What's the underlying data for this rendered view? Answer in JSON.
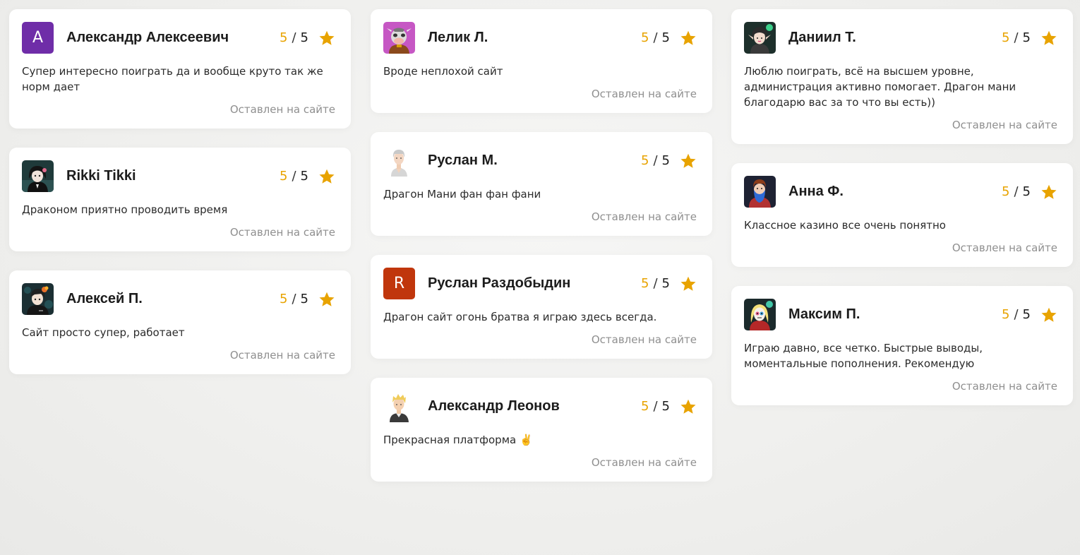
{
  "colors": {
    "accent": "#e8a300",
    "card_bg": "#ffffff",
    "page_bg": "#efefed"
  },
  "columns": [
    {
      "reviews": [
        {
          "name": "Александр Алексеевич",
          "avatar": {
            "type": "letter",
            "letter": "А",
            "color": "#6f2da8"
          },
          "score": "5",
          "max": "5",
          "text": "Супер интересно поиграть да и вообще круто так же норм дает",
          "source": "Оставлен на сайте"
        },
        {
          "name": "Rikki Tikki",
          "avatar": {
            "type": "image",
            "icon": "anime-girl-avatar-icon"
          },
          "score": "5",
          "max": "5",
          "text": "Драконом приятно проводить время",
          "source": "Оставлен на сайте"
        },
        {
          "name": "Алексей П.",
          "avatar": {
            "type": "image",
            "icon": "anime-boy-avatar-icon"
          },
          "score": "5",
          "max": "5",
          "text": "Сайт просто супер, работает",
          "source": "Оставлен на сайте"
        }
      ]
    },
    {
      "reviews": [
        {
          "name": "Лелик Л.",
          "avatar": {
            "type": "image",
            "icon": "cow-mask-avatar-icon"
          },
          "score": "5",
          "max": "5",
          "text": "Вроде неплохой сайт",
          "source": "Оставлен на сайте"
        },
        {
          "name": "Руслан М.",
          "avatar": {
            "type": "image",
            "icon": "gray-haired-man-avatar-icon"
          },
          "score": "5",
          "max": "5",
          "text": "Драгон Мани фан фан фани",
          "source": "Оставлен на сайте"
        },
        {
          "name": "Руслан Раздобыдин",
          "avatar": {
            "type": "letter",
            "letter": "R",
            "color": "#c0360c"
          },
          "score": "5",
          "max": "5",
          "text": "Драгон сайт огонь братва я играю здесь всегда.",
          "source": "Оставлен на сайте"
        },
        {
          "name": "Александр Леонов",
          "avatar": {
            "type": "image",
            "icon": "blond-man-avatar-icon"
          },
          "score": "5",
          "max": "5",
          "text": "Прекрасная платформа ✌️",
          "source": "Оставлен на сайте"
        }
      ]
    },
    {
      "reviews": [
        {
          "name": "Даниил Т.",
          "avatar": {
            "type": "image",
            "icon": "elf-girl-avatar-icon"
          },
          "score": "5",
          "max": "5",
          "text": "Люблю поиграть, всё на высшем уровне, администрация активно помогает. Драгон мани благодарю вас за то что вы есть))",
          "source": "Оставлен на сайте"
        },
        {
          "name": "Анна Ф.",
          "avatar": {
            "type": "image",
            "icon": "bearded-wizard-avatar-icon"
          },
          "score": "5",
          "max": "5",
          "text": "Классное казино все очень понятно",
          "source": "Оставлен на сайте"
        },
        {
          "name": "Максим П.",
          "avatar": {
            "type": "image",
            "icon": "skull-girl-avatar-icon"
          },
          "score": "5",
          "max": "5",
          "text": "Играю давно, все четко. Быстрые выводы, моментальные пополнения. Рекомендую",
          "source": "Оставлен на сайте"
        }
      ]
    }
  ]
}
